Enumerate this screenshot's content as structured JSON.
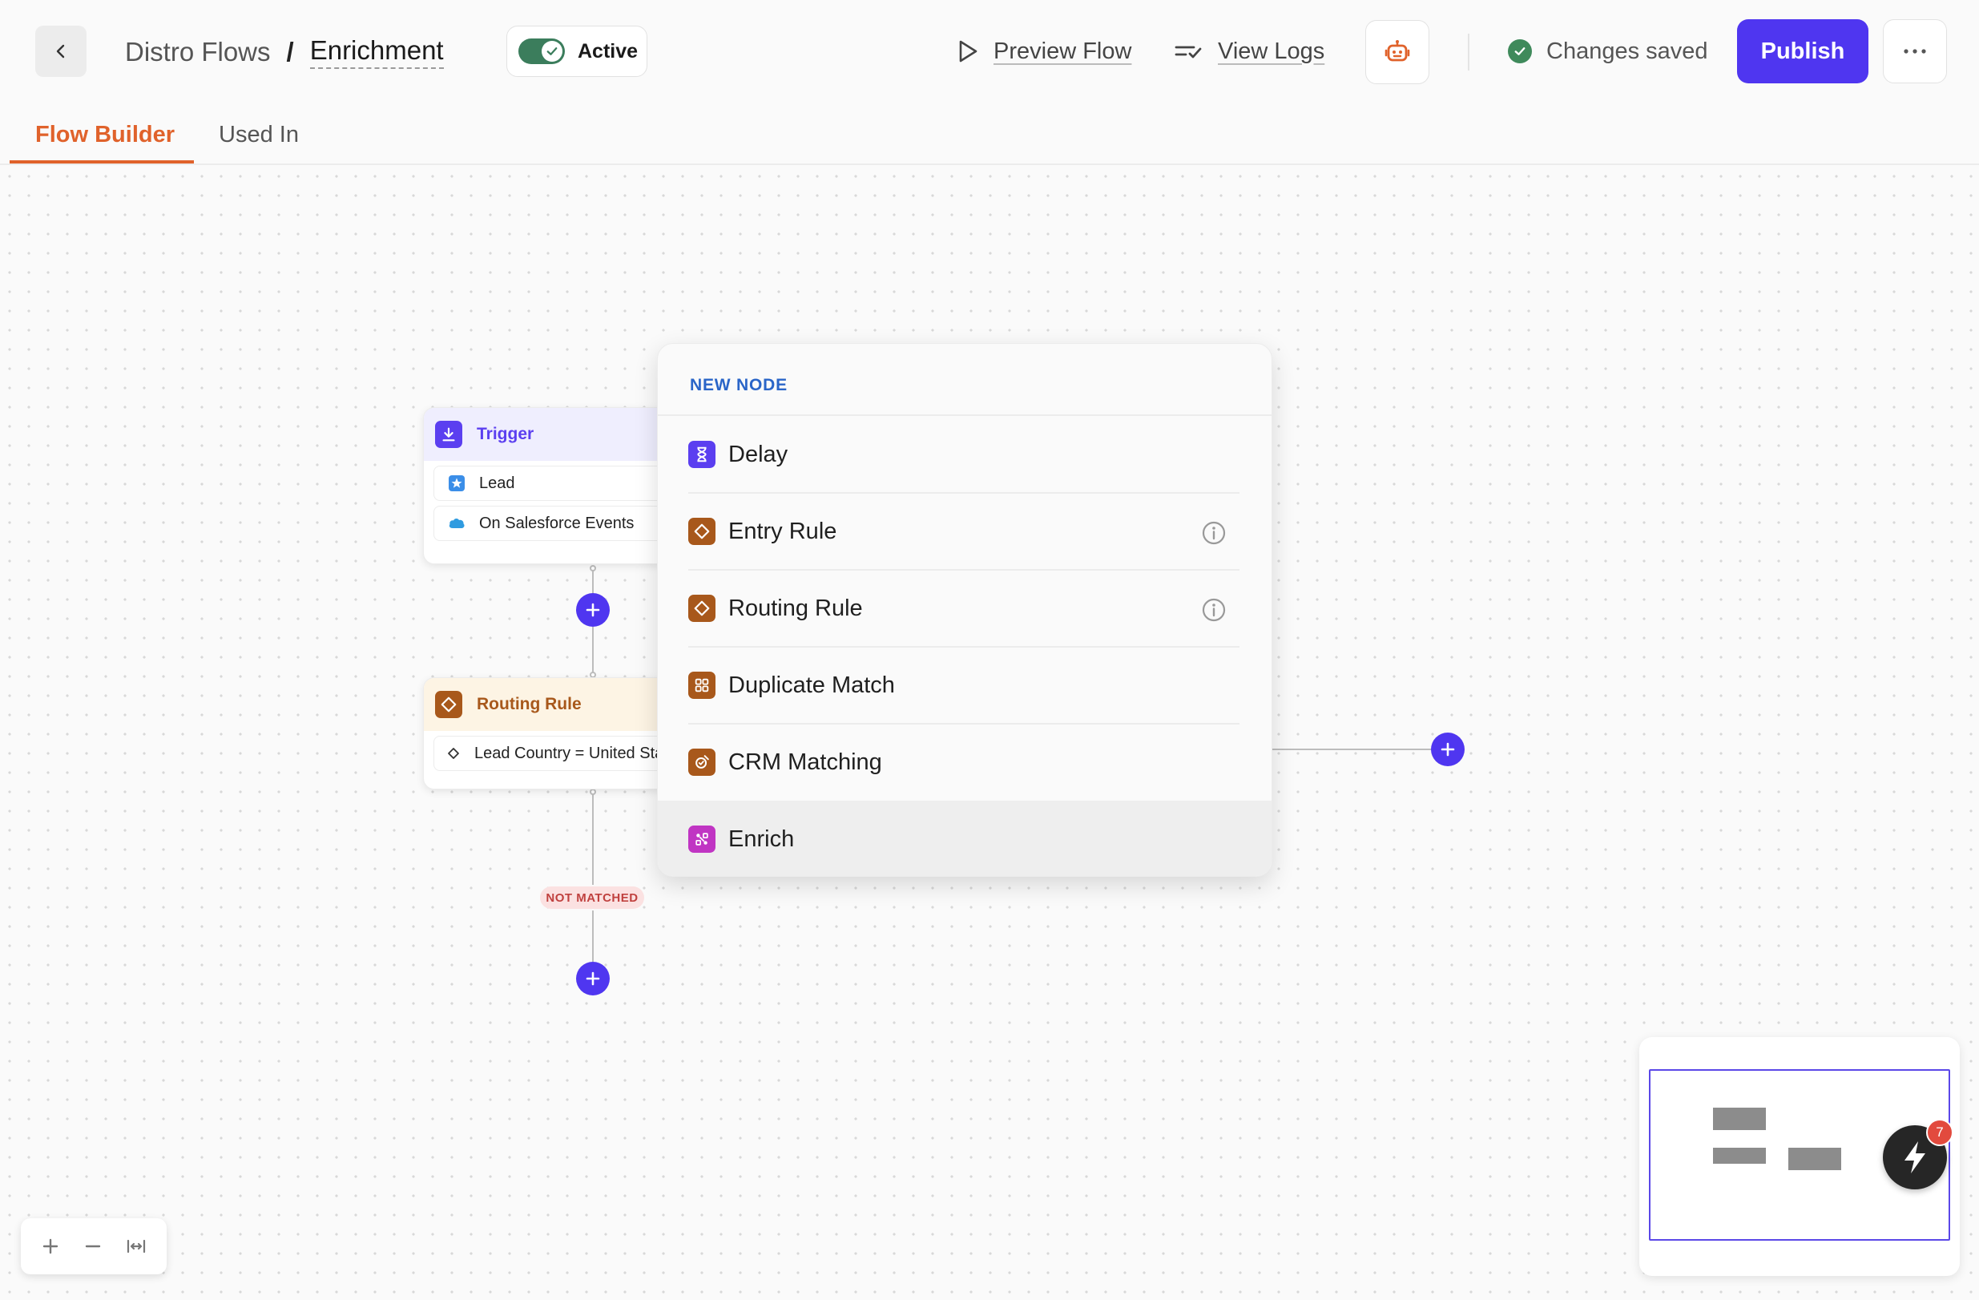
{
  "header": {
    "breadcrumb_parent": "Distro Flows",
    "breadcrumb_sep": "/",
    "breadcrumb_current": "Enrichment",
    "active_label": "Active",
    "preview_label": "Preview Flow",
    "logs_label": "View Logs",
    "saved_label": "Changes saved",
    "publish_label": "Publish"
  },
  "tabs": [
    {
      "label": "Flow Builder",
      "active": true
    },
    {
      "label": "Used In",
      "active": false
    }
  ],
  "nodes": {
    "trigger": {
      "title": "Trigger",
      "rows": [
        "Lead",
        "On Salesforce Events"
      ]
    },
    "routing": {
      "title": "Routing Rule",
      "rows": [
        "Lead Country = United States"
      ]
    },
    "not_matched": "NOT MATCHED"
  },
  "menu": {
    "title": "NEW NODE",
    "items": [
      {
        "label": "Delay",
        "icon": "hourglass-icon",
        "info": false
      },
      {
        "label": "Entry Rule",
        "icon": "diamond-icon",
        "info": true
      },
      {
        "label": "Routing Rule",
        "icon": "diamond-icon",
        "info": true
      },
      {
        "label": "Duplicate Match",
        "icon": "grid-icon",
        "info": false
      },
      {
        "label": "CRM Matching",
        "icon": "crm-match-icon",
        "info": false
      },
      {
        "label": "Enrich",
        "icon": "enrich-icon",
        "info": false,
        "highlighted": true
      }
    ]
  },
  "notifications": {
    "count": "7"
  },
  "colors": {
    "accent": "#4f36f0",
    "tab_active": "#e0622b",
    "toggle_on": "#3b7d5c",
    "trigger": "#5b3ff0",
    "routing": "#a8581b",
    "enrich": "#c035c3",
    "menu_title": "#2a65c8"
  }
}
